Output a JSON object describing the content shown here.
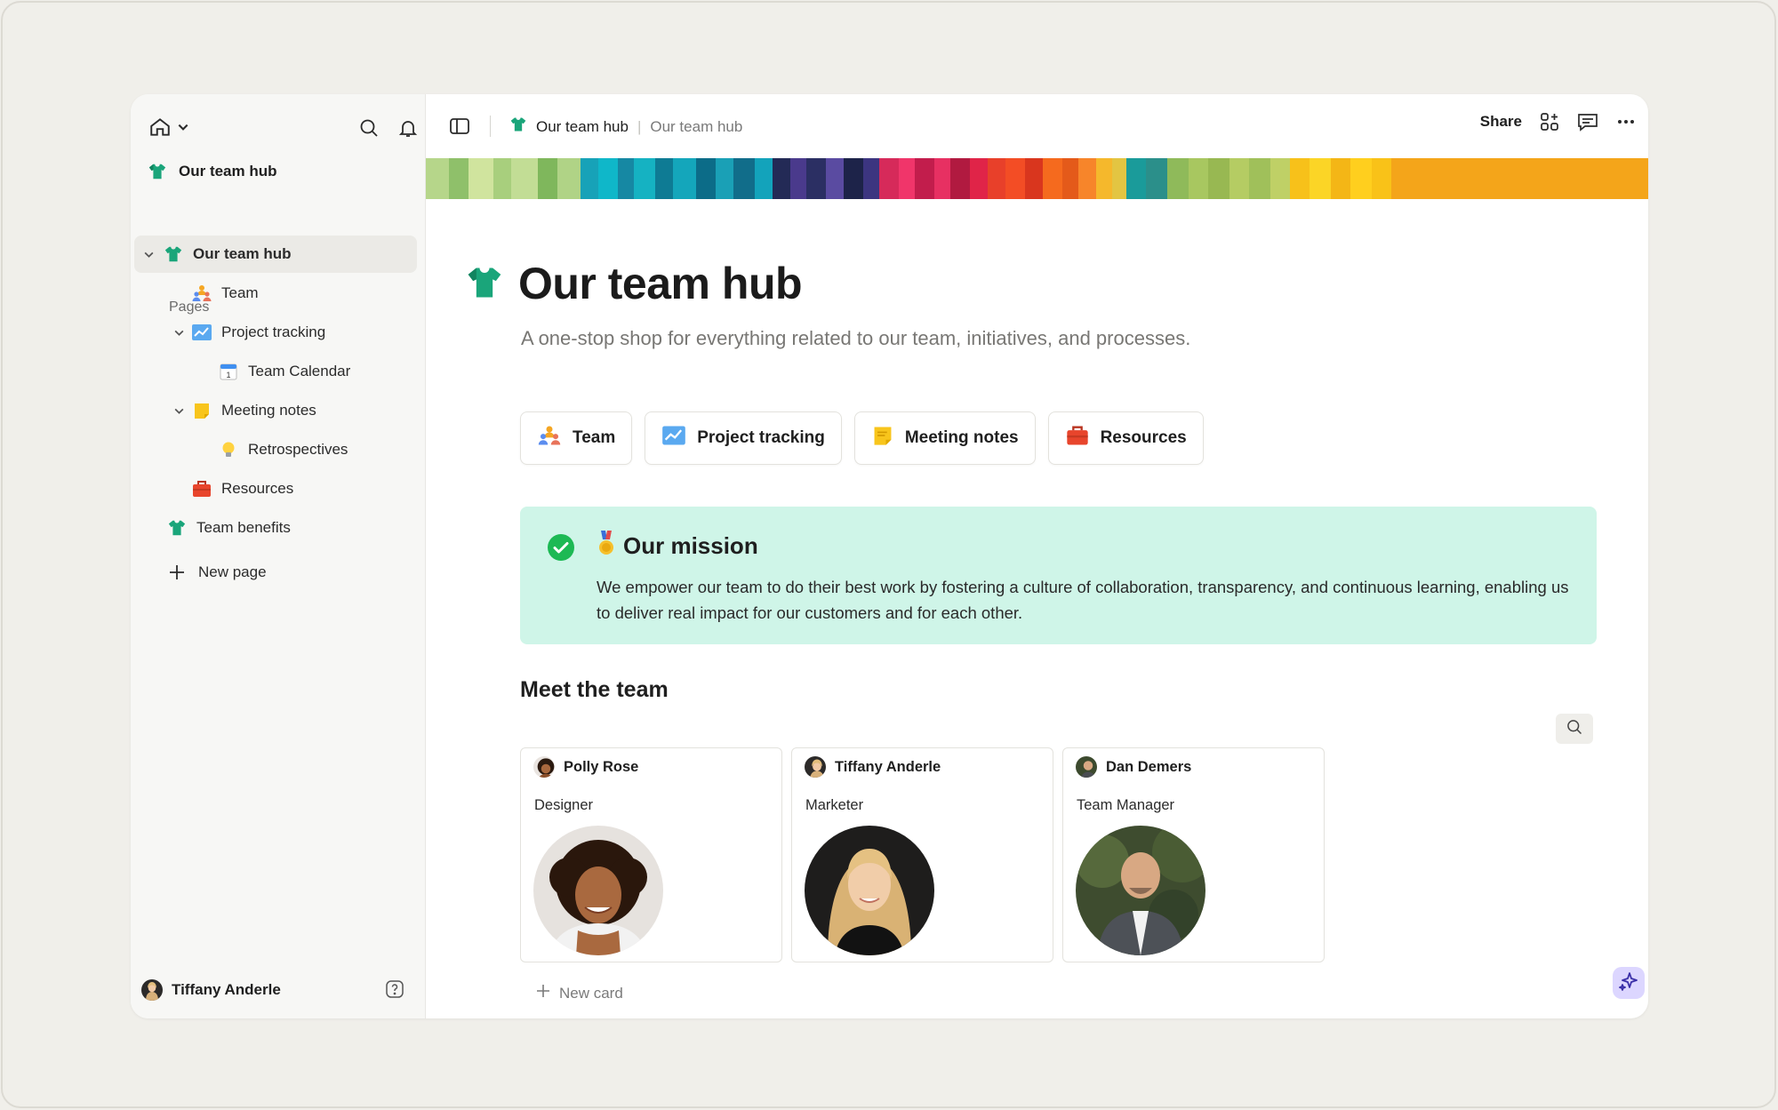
{
  "sidebar": {
    "workspace_name": "Our team hub",
    "pages_label": "Pages",
    "items": [
      {
        "label": "Our team hub",
        "icon": "team-jersey-icon"
      },
      {
        "label": "Team",
        "icon": "people-icon"
      },
      {
        "label": "Project tracking",
        "icon": "chart-icon"
      },
      {
        "label": "Team Calendar",
        "icon": "calendar-icon"
      },
      {
        "label": "Meeting notes",
        "icon": "notes-icon"
      },
      {
        "label": "Retrospectives",
        "icon": "lightbulb-icon"
      },
      {
        "label": "Resources",
        "icon": "briefcase-icon"
      },
      {
        "label": "Team benefits",
        "icon": "team-jersey-icon"
      }
    ],
    "new_page_label": "New page",
    "user_name": "Tiffany Anderle"
  },
  "topbar": {
    "breadcrumb_1": "Our team hub",
    "breadcrumb_sep": "|",
    "breadcrumb_2": "Our team hub",
    "share_label": "Share"
  },
  "page": {
    "title": "Our team hub",
    "subtitle": "A one-stop shop for everything related to our team, initiatives, and processes.",
    "chips": [
      {
        "label": "Team",
        "icon": "people-icon"
      },
      {
        "label": "Project tracking",
        "icon": "chart-icon"
      },
      {
        "label": "Meeting notes",
        "icon": "notes-icon"
      },
      {
        "label": "Resources",
        "icon": "briefcase-icon"
      }
    ],
    "mission": {
      "title": "Our mission",
      "body": "We empower our team to do their best work by fostering a culture of collaboration, transparency, and continuous learning, enabling us to deliver real impact for our customers and for each other."
    },
    "meet_title": "Meet the team",
    "cards": [
      {
        "name": "Polly Rose",
        "role": "Designer"
      },
      {
        "name": "Tiffany Anderle",
        "role": "Marketer"
      },
      {
        "name": "Dan Demers",
        "role": "Team Manager"
      }
    ],
    "new_card_label": "New card"
  },
  "colors": {
    "mission_bg": "#cff5e8",
    "check_green": "#1db954",
    "sidebar_bg": "#f7f7f5",
    "ai_button_bg": "#dcd6ff"
  }
}
